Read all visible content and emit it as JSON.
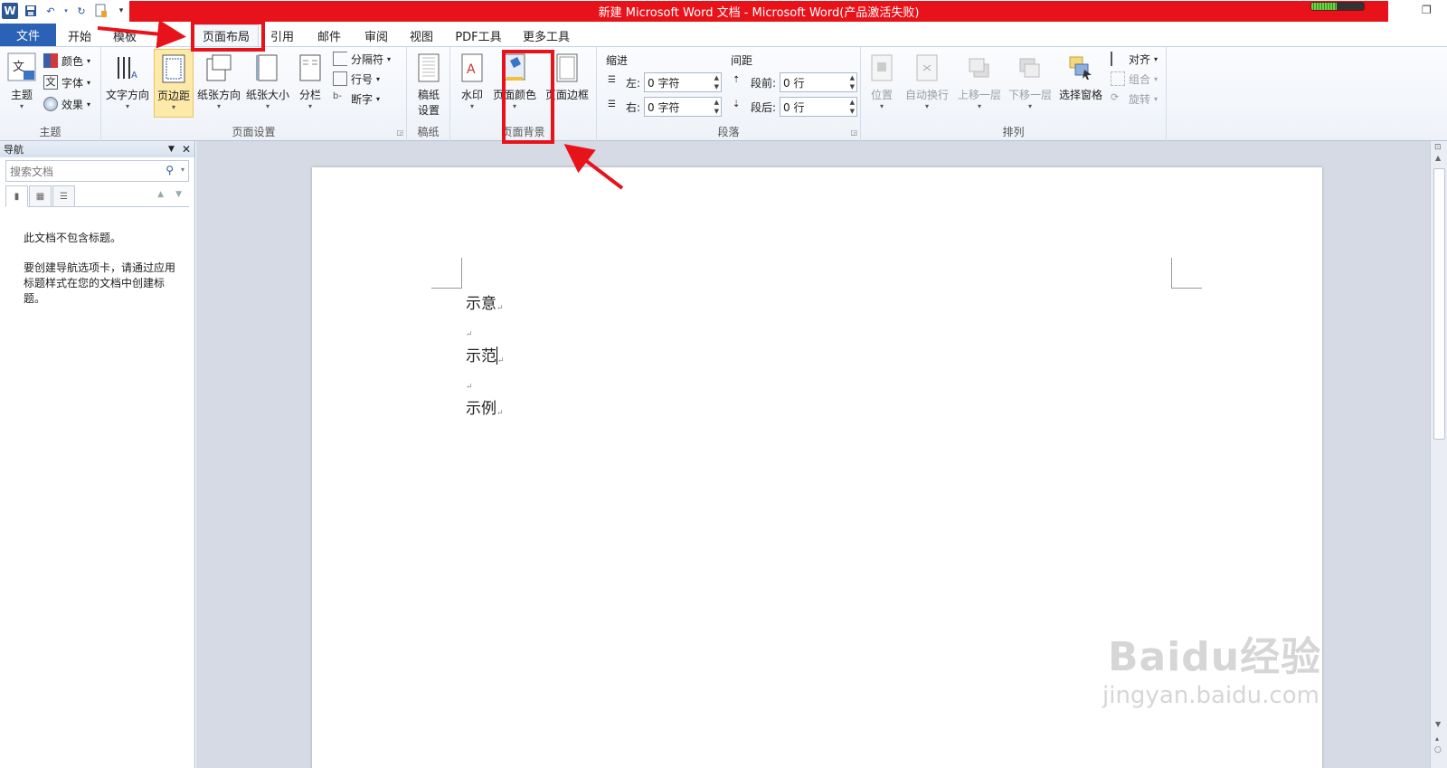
{
  "app": {
    "title": "新建 Microsoft Word 文档 - Microsoft Word(产品激活失败)",
    "logo_letter": "W"
  },
  "tabs": [
    "文件",
    "开始",
    "模板",
    "页面布局",
    "引用",
    "邮件",
    "审阅",
    "视图",
    "PDF工具",
    "更多工具"
  ],
  "active_tab": "页面布局",
  "ribbon": {
    "theme": {
      "label": "主题",
      "big": "主题",
      "small": [
        "颜色",
        "字体",
        "效果"
      ]
    },
    "page_setup": {
      "label": "页面设置",
      "big": [
        "文字方向",
        "页边距",
        "纸张方向",
        "纸张大小",
        "分栏"
      ],
      "small": [
        "分隔符",
        "行号",
        "断字"
      ]
    },
    "manuscript": {
      "label": "稿纸",
      "big_line1": "稿纸",
      "big_line2": "设置"
    },
    "page_background": {
      "label": "页面背景",
      "big": [
        "水印",
        "页面颜色",
        "页面边框"
      ]
    },
    "paragraph": {
      "label": "段落",
      "indent_title": "缩进",
      "spacing_title": "间距",
      "indent_left_label": "左:",
      "indent_left_value": "0 字符",
      "indent_right_label": "右:",
      "indent_right_value": "0 字符",
      "space_before_label": "段前:",
      "space_before_value": "0 行",
      "space_after_label": "段后:",
      "space_after_value": "0 行"
    },
    "arrange": {
      "label": "排列",
      "big": [
        "位置",
        "自动换行",
        "上移一层",
        "下移一层",
        "选择窗格"
      ],
      "small": [
        "对齐",
        "组合",
        "旋转"
      ]
    }
  },
  "nav": {
    "title": "导航",
    "search_placeholder": "搜索文档",
    "msg1": "此文档不包含标题。",
    "msg2": "要创建导航选项卡，请通过应用标题样式在您的文档中创建标题。"
  },
  "document": {
    "paragraphs": [
      "示意",
      "",
      "示范",
      "",
      "示例"
    ]
  },
  "watermark": {
    "logo": "Baidu经验",
    "url": "jingyan.baidu.com"
  },
  "colors": {
    "title_red": "#e8131a",
    "file_tab_blue": "#2b62b5",
    "annotation_red": "#e8131a"
  }
}
